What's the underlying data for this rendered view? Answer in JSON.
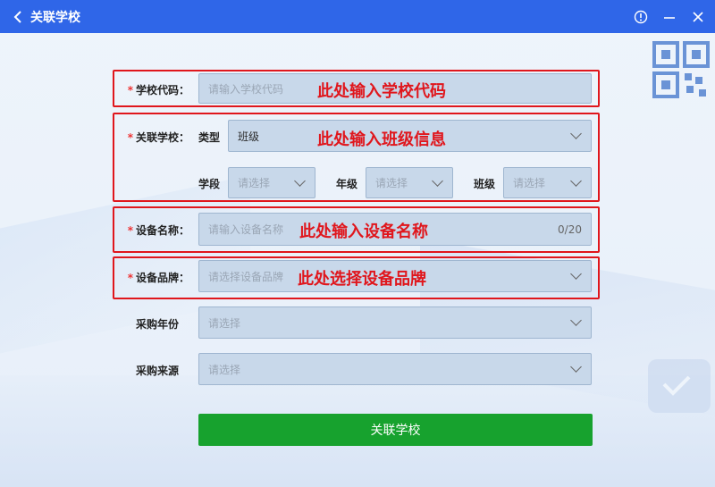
{
  "window": {
    "title": "关联学校",
    "back_icon": "chevron-left-icon",
    "info_icon": "info-circle-icon",
    "minimize_icon": "minimize-icon",
    "close_icon": "close-icon",
    "header_color": "#2f66e8"
  },
  "form": {
    "school_code": {
      "label": "学校代码：",
      "placeholder": "请输入学校代码",
      "annotation": "此处输入学校代码",
      "required": "*"
    },
    "school": {
      "label": "关联学校：",
      "required": "*",
      "annotation": "此处输入班级信息",
      "type_label": "类型",
      "type_value": "班级",
      "stage_label": "学段",
      "stage_placeholder": "请选择",
      "grade_label": "年级",
      "grade_placeholder": "请选择",
      "class_label": "班级",
      "class_placeholder": "请选择"
    },
    "device_name": {
      "label": "设备名称：",
      "required": "*",
      "placeholder": "请输入设备名称",
      "annotation": "此处输入设备名称",
      "counter": "0/20"
    },
    "device_brand": {
      "label": "设备品牌：",
      "required": "*",
      "placeholder": "请选择设备品牌",
      "annotation": "此处选择设备品牌"
    },
    "purchase_year": {
      "label": "采购年份",
      "placeholder": "请选择"
    },
    "purchase_source": {
      "label": "采购来源",
      "placeholder": "请选择"
    },
    "submit_label": "关联学校",
    "submit_color": "#17a22e",
    "annotation_color": "#e0161c"
  }
}
